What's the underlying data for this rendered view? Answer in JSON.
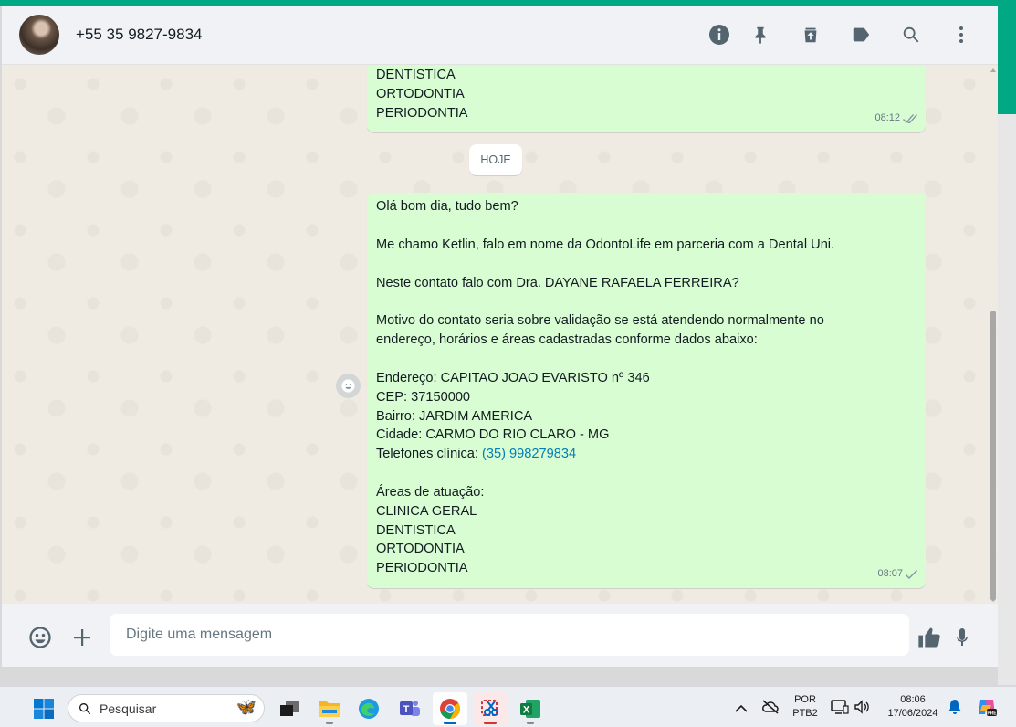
{
  "header": {
    "contact": "+55 35 9827-9834",
    "icons": [
      "info-icon",
      "pin-icon",
      "archive-icon",
      "label-icon",
      "search-icon",
      "more-options-icon"
    ]
  },
  "chat": {
    "previous_message": {
      "lines": [
        "DENTISTICA",
        "ORTODONTIA",
        "PERIODONTIA"
      ],
      "time": "08:12",
      "status": "read"
    },
    "day_separator": "HOJE",
    "message": {
      "greeting": "Olá bom dia, tudo bem?",
      "intro": "Me chamo Ketlin, falo em nome da OdontoLife em parceria com a Dental Uni.",
      "question": "Neste contato falo com Dra. DAYANE RAFAELA FERREIRA?",
      "motive_line1": "Motivo do contato seria sobre validação se está atendendo normalmente no",
      "motive_line2": "endereço, horários e áreas cadastradas conforme dados abaixo:",
      "address": "Endereço: CAPITAO JOAO EVARISTO nº 346",
      "cep": "CEP: 37150000",
      "bairro": "Bairro: JARDIM AMERICA",
      "cidade": "Cidade: CARMO DO RIO CLARO - MG",
      "phone_label": "Telefones clínica: ",
      "phone_link": "(35) 998279834",
      "areas_title": "Áreas de atuação:",
      "areas": [
        "CLINICA GERAL",
        "DENTISTICA",
        "ORTODONTIA",
        "PERIODONTIA"
      ],
      "time": "08:07",
      "status": "sent"
    }
  },
  "composer": {
    "placeholder": "Digite uma mensagem"
  },
  "taskbar": {
    "search_placeholder": "Pesquisar",
    "apps": [
      "task-view",
      "file-explorer",
      "edge",
      "teams",
      "chrome",
      "snipping-tool",
      "excel"
    ],
    "language": "POR",
    "keyboard": "PTB2",
    "time": "08:06",
    "date": "17/06/2024"
  },
  "colors": {
    "accent": "#00a884",
    "outgoing_bubble": "#d9fdd3",
    "chat_background": "#efeae2",
    "link": "#027eb5"
  }
}
